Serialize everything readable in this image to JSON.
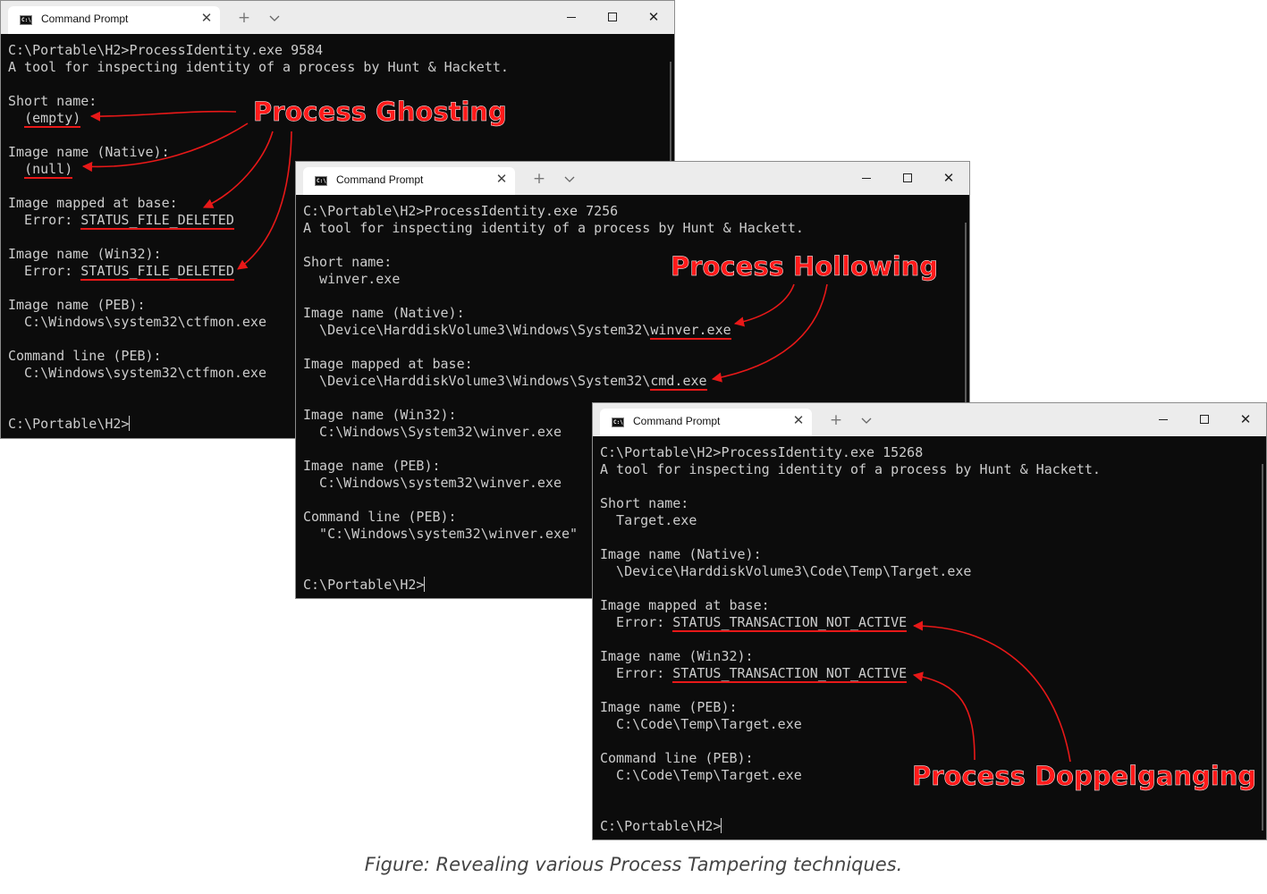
{
  "windows": [
    {
      "tab_title": "Command Prompt",
      "lines": [
        {
          "t": "C:\\Portable\\H2>ProcessIdentity.exe 9584"
        },
        {
          "t": "A tool for inspecting identity of a process by Hunt & Hackett."
        },
        {
          "t": ""
        },
        {
          "t": "Short name:"
        },
        {
          "t": "  ",
          "u": "(empty)"
        },
        {
          "t": ""
        },
        {
          "t": "Image name (Native):"
        },
        {
          "t": "  ",
          "u": "(null)"
        },
        {
          "t": ""
        },
        {
          "t": "Image mapped at base:"
        },
        {
          "t": "  Error: ",
          "u": "STATUS_FILE_DELETED"
        },
        {
          "t": ""
        },
        {
          "t": "Image name (Win32):"
        },
        {
          "t": "  Error: ",
          "u": "STATUS_FILE_DELETED"
        },
        {
          "t": ""
        },
        {
          "t": "Image name (PEB):"
        },
        {
          "t": "  C:\\Windows\\system32\\ctfmon.exe"
        },
        {
          "t": ""
        },
        {
          "t": "Command line (PEB):"
        },
        {
          "t": "  C:\\Windows\\system32\\ctfmon.exe"
        },
        {
          "t": ""
        },
        {
          "t": ""
        },
        {
          "t": "C:\\Portable\\H2>",
          "cursor": true
        }
      ]
    },
    {
      "tab_title": "Command Prompt",
      "lines": [
        {
          "t": "C:\\Portable\\H2>ProcessIdentity.exe 7256"
        },
        {
          "t": "A tool for inspecting identity of a process by Hunt & Hackett."
        },
        {
          "t": ""
        },
        {
          "t": "Short name:"
        },
        {
          "t": "  winver.exe"
        },
        {
          "t": ""
        },
        {
          "t": "Image name (Native):"
        },
        {
          "t": "  \\Device\\HarddiskVolume3\\Windows\\System32\\",
          "u": "winver.exe"
        },
        {
          "t": ""
        },
        {
          "t": "Image mapped at base:"
        },
        {
          "t": "  \\Device\\HarddiskVolume3\\Windows\\System32\\",
          "u": "cmd.exe"
        },
        {
          "t": ""
        },
        {
          "t": "Image name (Win32):"
        },
        {
          "t": "  C:\\Windows\\System32\\winver.exe"
        },
        {
          "t": ""
        },
        {
          "t": "Image name (PEB):"
        },
        {
          "t": "  C:\\Windows\\system32\\winver.exe"
        },
        {
          "t": ""
        },
        {
          "t": "Command line (PEB):"
        },
        {
          "t": "  \"C:\\Windows\\system32\\winver.exe\""
        },
        {
          "t": ""
        },
        {
          "t": ""
        },
        {
          "t": "C:\\Portable\\H2>",
          "cursor": true
        }
      ]
    },
    {
      "tab_title": "Command Prompt",
      "lines": [
        {
          "t": "C:\\Portable\\H2>ProcessIdentity.exe 15268"
        },
        {
          "t": "A tool for inspecting identity of a process by Hunt & Hackett."
        },
        {
          "t": ""
        },
        {
          "t": "Short name:"
        },
        {
          "t": "  Target.exe"
        },
        {
          "t": ""
        },
        {
          "t": "Image name (Native):"
        },
        {
          "t": "  \\Device\\HarddiskVolume3\\Code\\Temp\\Target.exe"
        },
        {
          "t": ""
        },
        {
          "t": "Image mapped at base:"
        },
        {
          "t": "  Error: ",
          "u": "STATUS_TRANSACTION_NOT_ACTIVE"
        },
        {
          "t": ""
        },
        {
          "t": "Image name (Win32):"
        },
        {
          "t": "  Error: ",
          "u": "STATUS_TRANSACTION_NOT_ACTIVE"
        },
        {
          "t": ""
        },
        {
          "t": "Image name (PEB):"
        },
        {
          "t": "  C:\\Code\\Temp\\Target.exe"
        },
        {
          "t": ""
        },
        {
          "t": "Command line (PEB):"
        },
        {
          "t": "  C:\\Code\\Temp\\Target.exe"
        },
        {
          "t": ""
        },
        {
          "t": ""
        },
        {
          "t": "C:\\Portable\\H2>",
          "cursor": true
        }
      ]
    }
  ],
  "annotations": {
    "ghosting": "Process Ghosting",
    "hollowing": "Process Hollowing",
    "doppelganging": "Process Doppelganging",
    "color": "#ff1a1a"
  },
  "caption": "Figure: Revealing various Process Tampering techniques.",
  "icons": {
    "tab_icon": "cmd-icon",
    "tab_close": "close-icon",
    "new_tab": "plus-icon",
    "dropdown": "chevron-down-icon",
    "minimize": "minimize-icon",
    "maximize": "maximize-icon",
    "close": "close-icon"
  }
}
